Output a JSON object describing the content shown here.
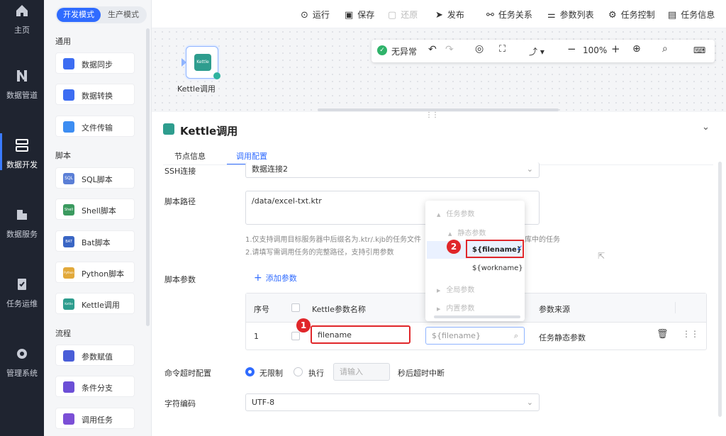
{
  "leftnav": {
    "items": [
      {
        "label": "主页",
        "icon": "home-icon"
      },
      {
        "label": "数据管道",
        "icon": "pipeline-icon"
      },
      {
        "label": "数据开发",
        "icon": "dev-icon"
      },
      {
        "label": "数据服务",
        "icon": "service-icon"
      },
      {
        "label": "任务运维",
        "icon": "ops-icon"
      },
      {
        "label": "管理系统",
        "icon": "gear-icon"
      }
    ]
  },
  "palette": {
    "mode_dev": "开发模式",
    "mode_prod": "生产模式",
    "cat_common": "通用",
    "cat_script": "脚本",
    "cat_flow": "流程",
    "tools": {
      "sync": "数据同步",
      "transform": "数据转换",
      "file": "文件传输",
      "sql": "SQL脚本",
      "shell": "Shell脚本",
      "bat": "Bat脚本",
      "python": "Python脚本",
      "kettle": "Kettle调用",
      "assign": "参数赋值",
      "branch": "条件分支",
      "call": "调用任务"
    },
    "icon_text": {
      "sql": "SQL",
      "shell": "Shell",
      "bat": "BAT",
      "python": "Python",
      "kettle": "Kettle"
    }
  },
  "toolbar": {
    "run": "运行",
    "save": "保存",
    "restore": "还原",
    "publish": "发布",
    "relations": "任务关系",
    "params": "参数列表",
    "control": "任务控制",
    "info": "任务信息"
  },
  "canvas": {
    "status": "无异常",
    "zoom": "100%",
    "node_label": "Kettle调用",
    "node_icon_text": "Kettle"
  },
  "panel": {
    "title": "Kettle调用",
    "tab_node_info": "节点信息",
    "tab_call_config": "调用配置",
    "ssh_label": "SSH连接",
    "ssh_value": "数据连接2",
    "path_label": "脚本路径",
    "path_value": "/data/excel-txt.ktr",
    "hint1": "1.仅支持调用目标服务器中后缀名为.ktr/.kjb的任务文件",
    "hint1_tail": "库中的任务",
    "hint2": "2.请填写需调用任务的完整路径，支持引用参数",
    "script_params_label": "脚本参数",
    "add_param": "添加参数",
    "col_seq": "序号",
    "col_name": "Kettle参数名称",
    "col_source": "参数来源",
    "row_seq": "1",
    "row_name": "filename",
    "row_value": "${filename}",
    "row_source": "任务静态参数",
    "timeout_label": "命令超时配置",
    "opt_unlimited": "无限制",
    "opt_exec": "执行",
    "timeout_placeholder": "请输入",
    "timeout_suffix": "秒后超时中断",
    "charset_label": "字符编码",
    "charset_value": "UTF-8"
  },
  "dropdown": {
    "task_params": "任务参数",
    "static_params": "静态参数",
    "opt1": "${filename}",
    "opt2": "${workname}",
    "global_params": "全局参数",
    "builtin_params": "内置参数"
  },
  "annotations": {
    "badge1": "1",
    "badge2": "2"
  }
}
